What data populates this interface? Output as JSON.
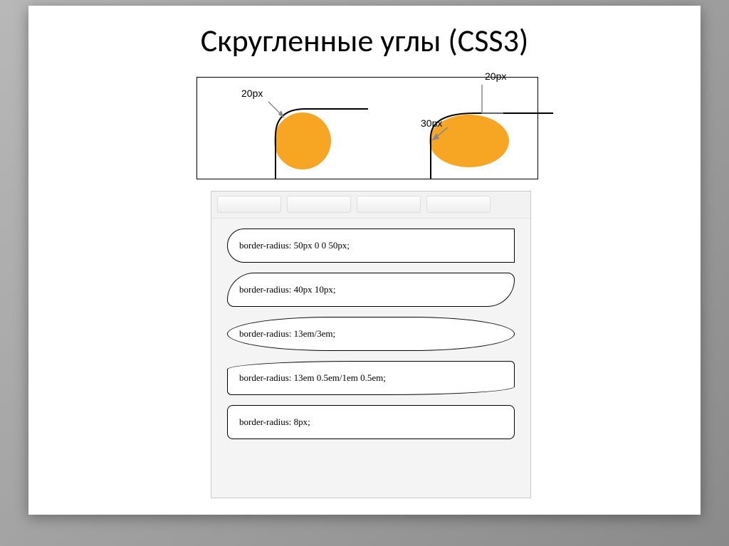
{
  "title": "Скругленные углы (CSS3)",
  "diagram": {
    "left_label": "20px",
    "right_top_label": "20px",
    "right_bottom_label": "30px"
  },
  "examples": [
    {
      "text": "border-radius: 50px 0 0 50px;"
    },
    {
      "text": "border-radius: 40px 10px;"
    },
    {
      "text": "border-radius: 13em/3em;"
    },
    {
      "text": "border-radius: 13em 0.5em/1em 0.5em;"
    },
    {
      "text": "border-radius: 8px;"
    }
  ]
}
